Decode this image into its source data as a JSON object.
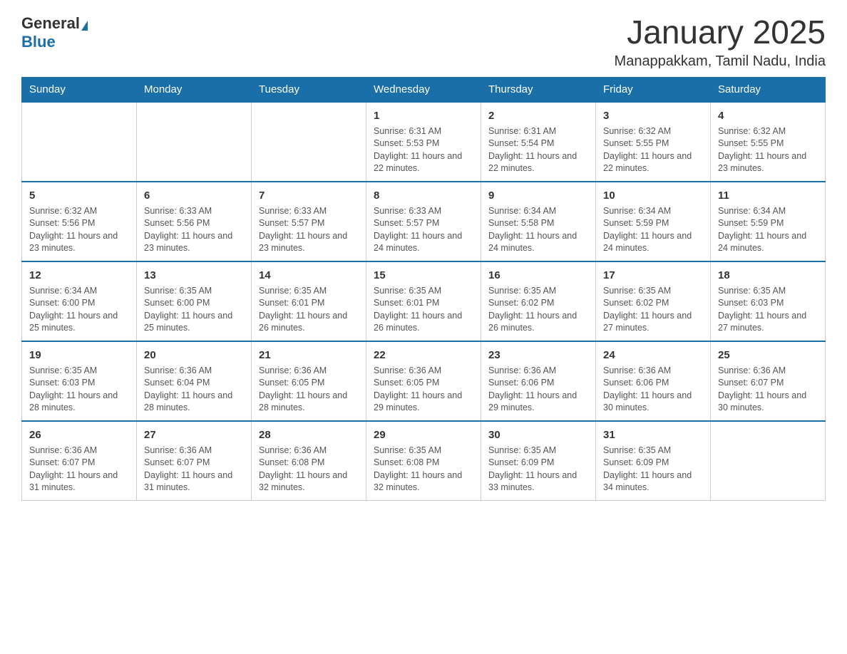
{
  "logo": {
    "general": "General",
    "blue": "Blue"
  },
  "title": "January 2025",
  "subtitle": "Manappakkam, Tamil Nadu, India",
  "weekdays": [
    "Sunday",
    "Monday",
    "Tuesday",
    "Wednesday",
    "Thursday",
    "Friday",
    "Saturday"
  ],
  "weeks": [
    [
      {
        "day": "",
        "info": ""
      },
      {
        "day": "",
        "info": ""
      },
      {
        "day": "",
        "info": ""
      },
      {
        "day": "1",
        "info": "Sunrise: 6:31 AM\nSunset: 5:53 PM\nDaylight: 11 hours and 22 minutes."
      },
      {
        "day": "2",
        "info": "Sunrise: 6:31 AM\nSunset: 5:54 PM\nDaylight: 11 hours and 22 minutes."
      },
      {
        "day": "3",
        "info": "Sunrise: 6:32 AM\nSunset: 5:55 PM\nDaylight: 11 hours and 22 minutes."
      },
      {
        "day": "4",
        "info": "Sunrise: 6:32 AM\nSunset: 5:55 PM\nDaylight: 11 hours and 23 minutes."
      }
    ],
    [
      {
        "day": "5",
        "info": "Sunrise: 6:32 AM\nSunset: 5:56 PM\nDaylight: 11 hours and 23 minutes."
      },
      {
        "day": "6",
        "info": "Sunrise: 6:33 AM\nSunset: 5:56 PM\nDaylight: 11 hours and 23 minutes."
      },
      {
        "day": "7",
        "info": "Sunrise: 6:33 AM\nSunset: 5:57 PM\nDaylight: 11 hours and 23 minutes."
      },
      {
        "day": "8",
        "info": "Sunrise: 6:33 AM\nSunset: 5:57 PM\nDaylight: 11 hours and 24 minutes."
      },
      {
        "day": "9",
        "info": "Sunrise: 6:34 AM\nSunset: 5:58 PM\nDaylight: 11 hours and 24 minutes."
      },
      {
        "day": "10",
        "info": "Sunrise: 6:34 AM\nSunset: 5:59 PM\nDaylight: 11 hours and 24 minutes."
      },
      {
        "day": "11",
        "info": "Sunrise: 6:34 AM\nSunset: 5:59 PM\nDaylight: 11 hours and 24 minutes."
      }
    ],
    [
      {
        "day": "12",
        "info": "Sunrise: 6:34 AM\nSunset: 6:00 PM\nDaylight: 11 hours and 25 minutes."
      },
      {
        "day": "13",
        "info": "Sunrise: 6:35 AM\nSunset: 6:00 PM\nDaylight: 11 hours and 25 minutes."
      },
      {
        "day": "14",
        "info": "Sunrise: 6:35 AM\nSunset: 6:01 PM\nDaylight: 11 hours and 26 minutes."
      },
      {
        "day": "15",
        "info": "Sunrise: 6:35 AM\nSunset: 6:01 PM\nDaylight: 11 hours and 26 minutes."
      },
      {
        "day": "16",
        "info": "Sunrise: 6:35 AM\nSunset: 6:02 PM\nDaylight: 11 hours and 26 minutes."
      },
      {
        "day": "17",
        "info": "Sunrise: 6:35 AM\nSunset: 6:02 PM\nDaylight: 11 hours and 27 minutes."
      },
      {
        "day": "18",
        "info": "Sunrise: 6:35 AM\nSunset: 6:03 PM\nDaylight: 11 hours and 27 minutes."
      }
    ],
    [
      {
        "day": "19",
        "info": "Sunrise: 6:35 AM\nSunset: 6:03 PM\nDaylight: 11 hours and 28 minutes."
      },
      {
        "day": "20",
        "info": "Sunrise: 6:36 AM\nSunset: 6:04 PM\nDaylight: 11 hours and 28 minutes."
      },
      {
        "day": "21",
        "info": "Sunrise: 6:36 AM\nSunset: 6:05 PM\nDaylight: 11 hours and 28 minutes."
      },
      {
        "day": "22",
        "info": "Sunrise: 6:36 AM\nSunset: 6:05 PM\nDaylight: 11 hours and 29 minutes."
      },
      {
        "day": "23",
        "info": "Sunrise: 6:36 AM\nSunset: 6:06 PM\nDaylight: 11 hours and 29 minutes."
      },
      {
        "day": "24",
        "info": "Sunrise: 6:36 AM\nSunset: 6:06 PM\nDaylight: 11 hours and 30 minutes."
      },
      {
        "day": "25",
        "info": "Sunrise: 6:36 AM\nSunset: 6:07 PM\nDaylight: 11 hours and 30 minutes."
      }
    ],
    [
      {
        "day": "26",
        "info": "Sunrise: 6:36 AM\nSunset: 6:07 PM\nDaylight: 11 hours and 31 minutes."
      },
      {
        "day": "27",
        "info": "Sunrise: 6:36 AM\nSunset: 6:07 PM\nDaylight: 11 hours and 31 minutes."
      },
      {
        "day": "28",
        "info": "Sunrise: 6:36 AM\nSunset: 6:08 PM\nDaylight: 11 hours and 32 minutes."
      },
      {
        "day": "29",
        "info": "Sunrise: 6:35 AM\nSunset: 6:08 PM\nDaylight: 11 hours and 32 minutes."
      },
      {
        "day": "30",
        "info": "Sunrise: 6:35 AM\nSunset: 6:09 PM\nDaylight: 11 hours and 33 minutes."
      },
      {
        "day": "31",
        "info": "Sunrise: 6:35 AM\nSunset: 6:09 PM\nDaylight: 11 hours and 34 minutes."
      },
      {
        "day": "",
        "info": ""
      }
    ]
  ]
}
